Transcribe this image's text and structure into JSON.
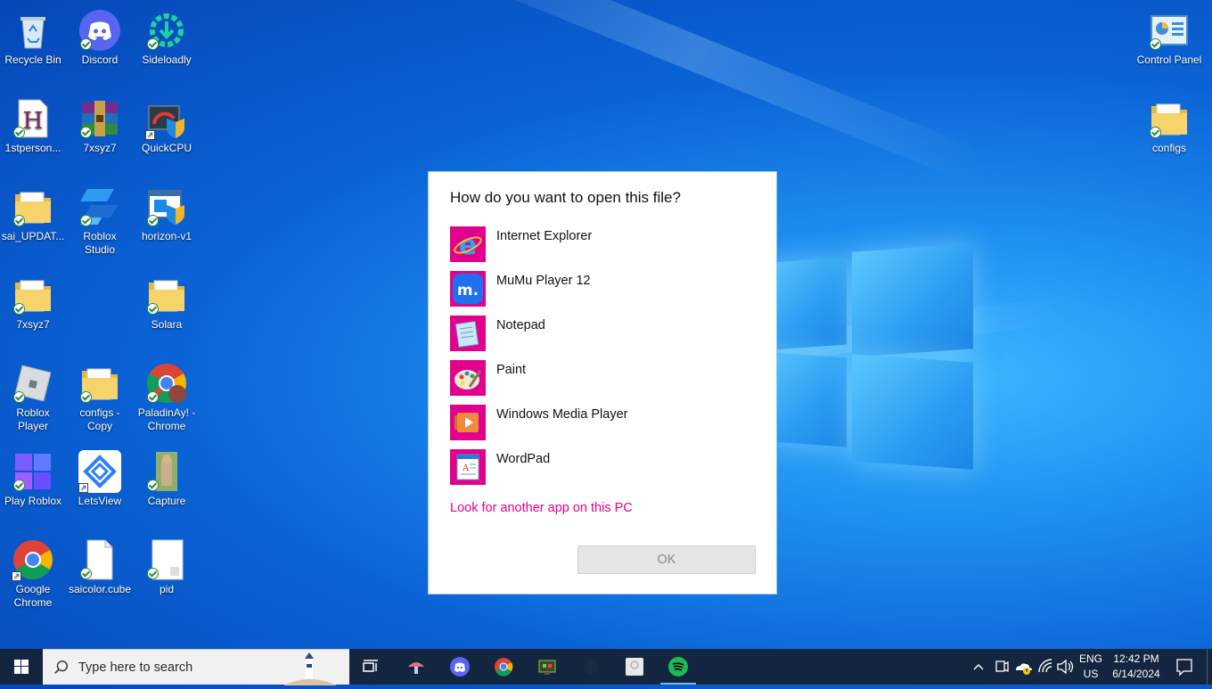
{
  "desktop_icons": [
    {
      "label": "Recycle Bin",
      "icon": "recycle-bin-icon"
    },
    {
      "label": "Discord",
      "icon": "discord-icon"
    },
    {
      "label": "Sideloadly",
      "icon": "sideloadly-icon"
    },
    {
      "label": "Control Panel",
      "icon": "control-panel-icon"
    },
    {
      "label": "1stperson...",
      "icon": "h-document-icon"
    },
    {
      "label": "7xsyz7",
      "icon": "winrar-icon"
    },
    {
      "label": "QuickCPU",
      "icon": "quickcpu-icon"
    },
    {
      "label": "configs",
      "icon": "folder-icon"
    },
    {
      "label": "sai_UPDAT...",
      "icon": "folder-icon"
    },
    {
      "label": "Roblox Studio",
      "icon": "roblox-studio-icon"
    },
    {
      "label": "horizon-v1",
      "icon": "installer-icon"
    },
    {
      "label": "7xsyz7",
      "icon": "folder-icon"
    },
    {
      "label": "Solara",
      "icon": "folder-icon"
    },
    {
      "label": "Roblox Player",
      "icon": "roblox-player-icon"
    },
    {
      "label": "configs - Copy",
      "icon": "folder-icon"
    },
    {
      "label": "PaladinAy! - Chrome",
      "icon": "chrome-icon"
    },
    {
      "label": "Play Roblox",
      "icon": "play-roblox-icon"
    },
    {
      "label": "LetsView",
      "icon": "letsview-icon"
    },
    {
      "label": "Capture",
      "icon": "image-file-icon"
    },
    {
      "label": "Google Chrome",
      "icon": "chrome-icon"
    },
    {
      "label": "saicolor.cube",
      "icon": "blank-file-icon"
    },
    {
      "label": "pid",
      "icon": "blank-file-icon"
    }
  ],
  "dialog": {
    "title": "How do you want to open this file?",
    "apps": [
      {
        "name": "Internet Explorer",
        "icon": "internet-explorer-icon"
      },
      {
        "name": "MuMu Player 12",
        "icon": "mumu-player-icon"
      },
      {
        "name": "Notepad",
        "icon": "notepad-icon"
      },
      {
        "name": "Paint",
        "icon": "paint-icon"
      },
      {
        "name": "Windows Media Player",
        "icon": "media-player-icon"
      },
      {
        "name": "WordPad",
        "icon": "wordpad-icon"
      }
    ],
    "look_link": "Look for another app on this PC",
    "ok_label": "OK",
    "accent": "#e3008c"
  },
  "taskbar": {
    "search_placeholder": "Type here to search",
    "lang_line1": "ENG",
    "lang_line2": "US",
    "time": "12:42 PM",
    "date": "6/14/2024",
    "color": "#14253f"
  }
}
